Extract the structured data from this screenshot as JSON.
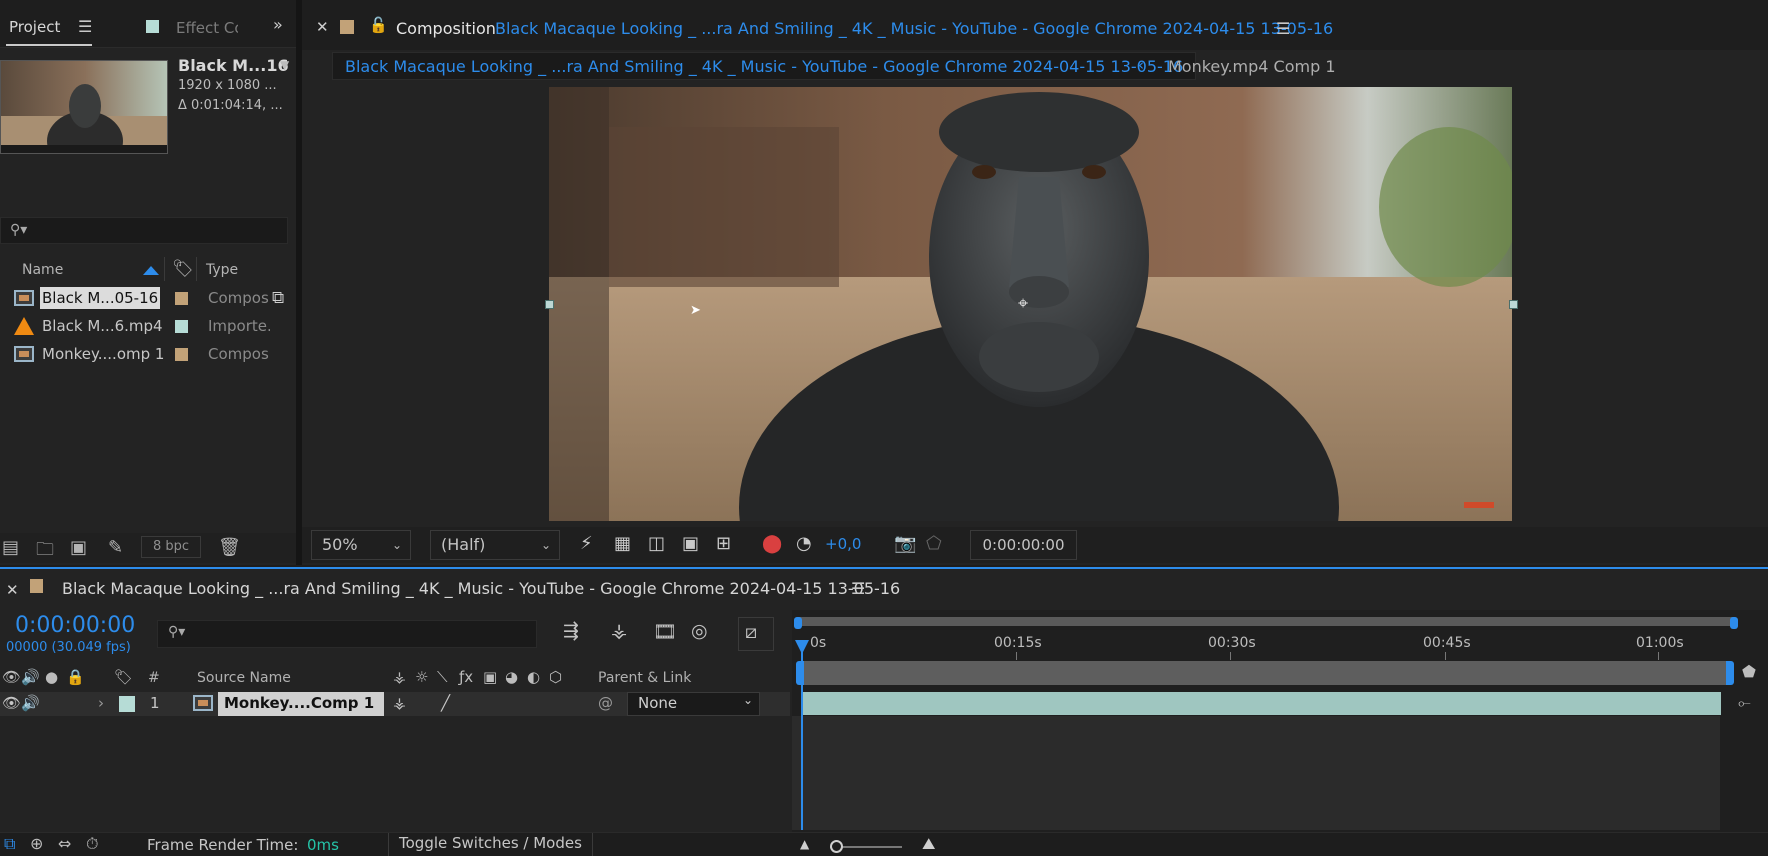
{
  "project_panel": {
    "tab_project": "Project",
    "tab_effect": "Effect Co",
    "selected_name": "Black M...16",
    "selected_info": [
      "1920 x 1080 ...",
      "Δ 0:01:04:14, ..."
    ],
    "search_placeholder": "",
    "columns": {
      "name": "Name",
      "type": "Type"
    },
    "items": [
      {
        "name": "Black M...05-16",
        "type": "Composi",
        "label_color": "#c2a278",
        "icon": "composition-icon",
        "selected": true
      },
      {
        "name": "Black M...6.mp4",
        "type": "Importe.",
        "label_color": "#b6dcd6",
        "icon": "vlc-cone-icon",
        "selected": false
      },
      {
        "name": "Monkey....omp 1",
        "type": "Composi",
        "label_color": "#c2a278",
        "icon": "composition-icon",
        "selected": false
      }
    ],
    "bpc": "8 bpc"
  },
  "composition_panel": {
    "label": "Composition",
    "title": "Black Macaque Looking _ ...ra And Smiling _ 4K _ Music - YouTube - Google Chrome 2024-04-15 13-05-16",
    "breadcrumb_active": "Black Macaque Looking _ ...ra And Smiling _ 4K _ Music - YouTube - Google Chrome 2024-04-15 13-05-16",
    "breadcrumb_next": "Monkey.mp4 Comp 1",
    "zoom": "50%",
    "resolution": "(Half)",
    "exposure": "+0,0",
    "current_time": "0:00:00:00"
  },
  "timeline_panel": {
    "title": "Black Macaque Looking _ ...ra And Smiling _ 4K _ Music - YouTube - Google Chrome 2024-04-15 13-05-16",
    "timecode": "0:00:00:00",
    "frames": "00000 (30.049 fps)",
    "columns": {
      "number": "#",
      "source_name": "Source Name",
      "parent_link": "Parent & Link"
    },
    "ruler": [
      "0s",
      "00:15s",
      "00:30s",
      "00:45s",
      "01:00s"
    ],
    "layers": [
      {
        "number": "1",
        "name": "Monkey....Comp 1",
        "parent": "None",
        "label_color": "#b6dcd6"
      }
    ]
  },
  "status_bar": {
    "frame_render_label": "Frame Render Time:",
    "frame_render_value": "0ms",
    "toggle_label": "Toggle Switches / Modes"
  },
  "colors": {
    "accent": "#2d8ceb",
    "panel": "#232323",
    "layer_bar": "#9fc6c0"
  }
}
